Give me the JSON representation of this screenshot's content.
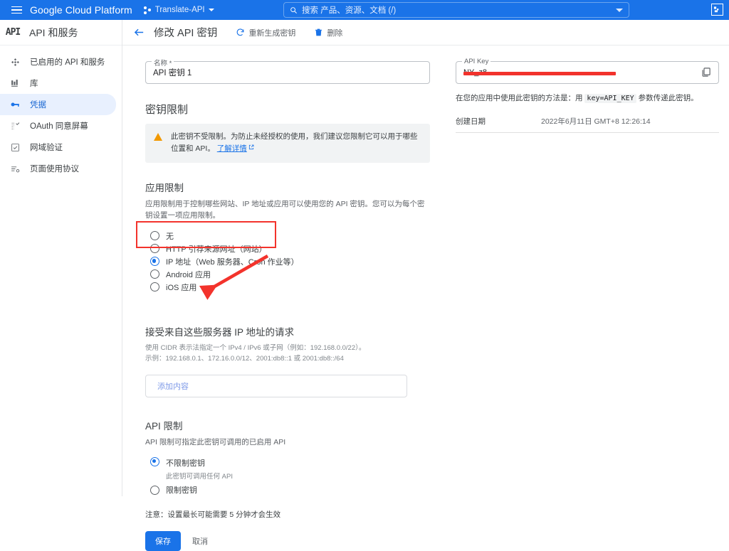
{
  "topbar": {
    "menu_icon": "hamburger-icon",
    "brand": "Google Cloud Platform",
    "project": "Translate-API",
    "search": {
      "icon": "search-icon",
      "placeholder": "搜索  产品、资源、文档 (/)"
    },
    "right_icon": "cloud-shell-icon"
  },
  "sidebar": {
    "product_glyph": "API",
    "title": "API 和服务",
    "items": [
      {
        "label": "已启用的 API 和服务",
        "icon": "dashboard-icon",
        "active": false
      },
      {
        "label": "库",
        "icon": "library-icon",
        "active": false
      },
      {
        "label": "凭据",
        "icon": "key-icon",
        "active": true
      },
      {
        "label": "OAuth 同意屏幕",
        "icon": "consent-screen-icon",
        "active": false
      },
      {
        "label": "网域验证",
        "icon": "domain-verification-icon",
        "active": false
      },
      {
        "label": "页面使用协议",
        "icon": "terms-icon",
        "active": false
      }
    ]
  },
  "page": {
    "back_icon": "back-arrow-icon",
    "title": "修改 API 密钥",
    "actions": [
      {
        "label": "重新生成密钥",
        "icon": "refresh-icon"
      },
      {
        "label": "删除",
        "icon": "trash-icon"
      }
    ]
  },
  "form": {
    "name_field": {
      "label": "名称 *",
      "value": "API 密钥 1"
    },
    "key_restrictions": {
      "heading": "密钥限制",
      "warning": {
        "icon": "warning-triangle-icon",
        "text": "此密钥不受限制。为防止未经授权的使用，我们建议您限制它可以用于哪些位置和 API。",
        "link": "了解详情",
        "link_icon": "external-link-icon"
      }
    },
    "app_restrictions": {
      "heading": "应用限制",
      "description": "应用限制用于控制哪些网站、IP 地址或应用可以使用您的 API 密钥。您可以为每个密钥设置一项应用限制。",
      "options": [
        {
          "label": "无",
          "selected": false
        },
        {
          "label": "HTTP 引荐来源网址（网站）",
          "selected": false
        },
        {
          "label": "IP 地址（Web 服务器、Cron 作业等）",
          "selected": true
        },
        {
          "label": "Android 应用",
          "selected": false
        },
        {
          "label": "iOS 应用",
          "selected": false
        }
      ]
    },
    "ip_section": {
      "heading": "接受来自这些服务器 IP 地址的请求",
      "hint_line1": "使用 CIDR 表示法指定一个 IPv4 / IPv6 或子网（例如：192.168.0.0/22）。",
      "hint_line2": "示例：192.168.0.1、172.16.0.0/12、2001:db8::1 或 2001:db8::/64",
      "add_label": "添加内容"
    },
    "api_restrictions": {
      "heading": "API 限制",
      "description": "API 限制可指定此密钥可调用的已启用 API",
      "options": [
        {
          "label": "不限制密钥",
          "sublabel": "此密钥可调用任何 API",
          "selected": true
        },
        {
          "label": "限制密钥",
          "sublabel": "",
          "selected": false
        }
      ]
    },
    "note": "注意：设置最长可能需要 5 分钟才会生效",
    "save_label": "保存",
    "cancel_label": "取消"
  },
  "details": {
    "api_key_field": {
      "label": "API Key",
      "value_visible_suffix": "NY_z8",
      "redacted": true
    },
    "copy_icon": "copy-icon",
    "usage_prefix": "在您的应用中使用此密钥的方法是：用 ",
    "usage_code": "key=API_KEY",
    "usage_suffix": " 参数传递此密钥。",
    "created_label": "创建日期",
    "created_value": "2022年6月11日 GMT+8 12:26:14"
  },
  "annotations": {
    "highlight_color": "#f3332c",
    "box_target": "IP 地址（Web 服务器、Cron 作业等）",
    "arrow_target": "接受来自这些服务器 IP 地址的请求"
  }
}
